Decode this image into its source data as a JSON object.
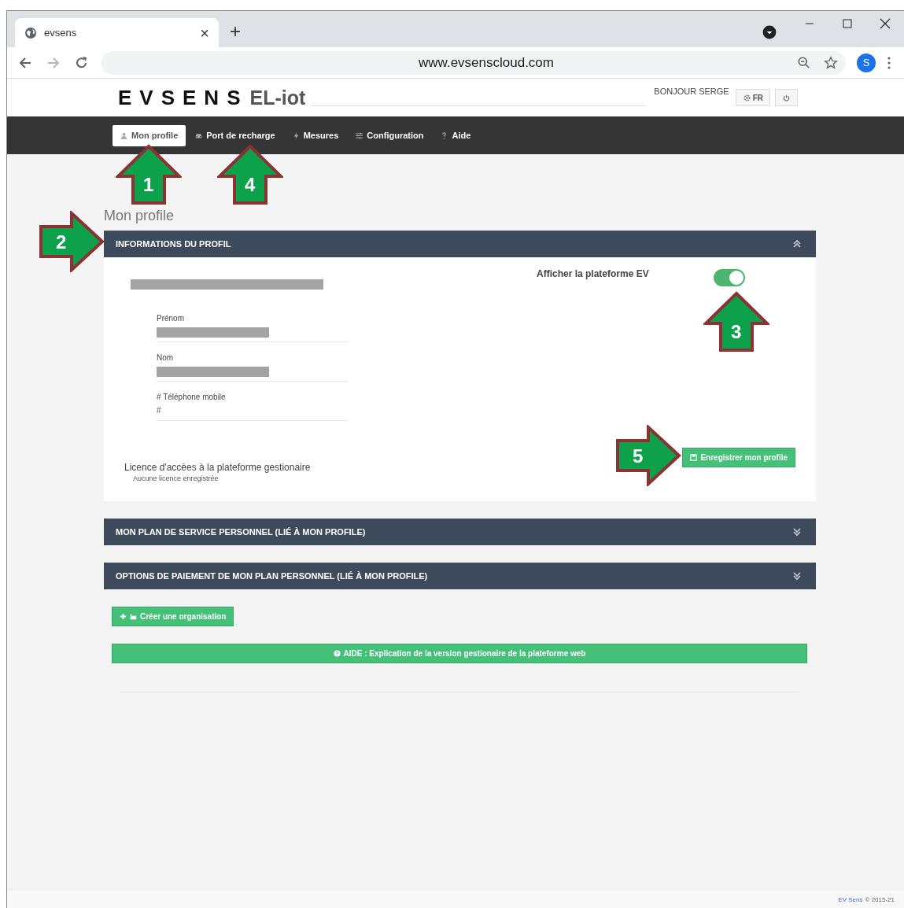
{
  "browser": {
    "tab_title": "evsens",
    "tab_close": "×",
    "new_tab": "+",
    "url": "www.evsenscloud.com",
    "profile_initial": "S"
  },
  "header": {
    "logo": "EVSENS",
    "product": "EL-iot",
    "greeting": "BONJOUR SERGE",
    "language": "FR"
  },
  "nav": [
    {
      "label": "Mon profile",
      "kind": "user",
      "selected": true
    },
    {
      "label": "Port de recharge",
      "kind": "car",
      "selected": false
    },
    {
      "label": "Mesures",
      "kind": "bolt",
      "selected": false
    },
    {
      "label": "Configuration",
      "kind": "sliders",
      "selected": false
    },
    {
      "label": "Aide",
      "kind": "question",
      "selected": false
    }
  ],
  "page_title": "Mon profile",
  "panels": [
    {
      "title": "INFORMATIONS DU PROFIL",
      "expanded": true
    },
    {
      "title": "MON PLAN DE SERVICE PERSONNEL (LIÉ À MON PROFILE)",
      "expanded": false
    },
    {
      "title": "OPTIONS DE PAIEMENT DE MON PLAN PERSONNEL (LIÉ À MON PROFILE)",
      "expanded": false
    }
  ],
  "profile": {
    "fields": [
      {
        "label": "Prénom",
        "kind": "redacted"
      },
      {
        "label": "Nom",
        "kind": "redacted"
      },
      {
        "label": "# Téléphone mobile",
        "kind": "text",
        "value": "#"
      }
    ],
    "toggle": {
      "label": "Afficher la plateforme EV",
      "on": true
    },
    "save_button": "Enregistrer mon profile",
    "licence_title": "Licence d'accèes à la plateforme gestionaire",
    "licence_status": "Aucune licence enregistrée"
  },
  "create_button": "Créer une organisation",
  "help_bar": "AIDE : Explication de la version gestionaire de la plateforme web",
  "footer": {
    "brand": "EV Sens",
    "copyright": "© 2015-21"
  },
  "annotations": [
    {
      "label": "1",
      "kind": "up"
    },
    {
      "label": "4",
      "kind": "up"
    },
    {
      "label": "2",
      "kind": "right"
    },
    {
      "label": "3",
      "kind": "up"
    },
    {
      "label": "5",
      "kind": "right"
    }
  ]
}
